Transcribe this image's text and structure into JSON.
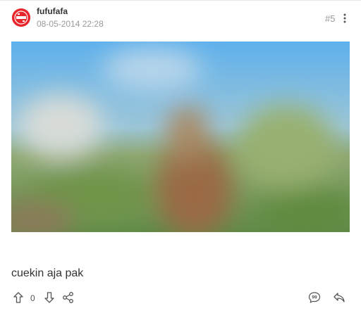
{
  "post": {
    "username": "fufufafa",
    "timestamp": "08-05-2014 22:28",
    "post_number": "#5",
    "image_alt": "",
    "body_text": "cuekin aja pak",
    "vote_count": "0"
  },
  "icons": {
    "more": "more-vertical-icon",
    "upvote": "arrow-up-icon",
    "downvote": "arrow-down-icon",
    "share": "share-icon",
    "quote": "quote-bubble-icon",
    "reply": "reply-icon"
  },
  "colors": {
    "avatar_bg": "#e8262b",
    "muted_text": "#9a9a9a",
    "icon": "#555555"
  }
}
